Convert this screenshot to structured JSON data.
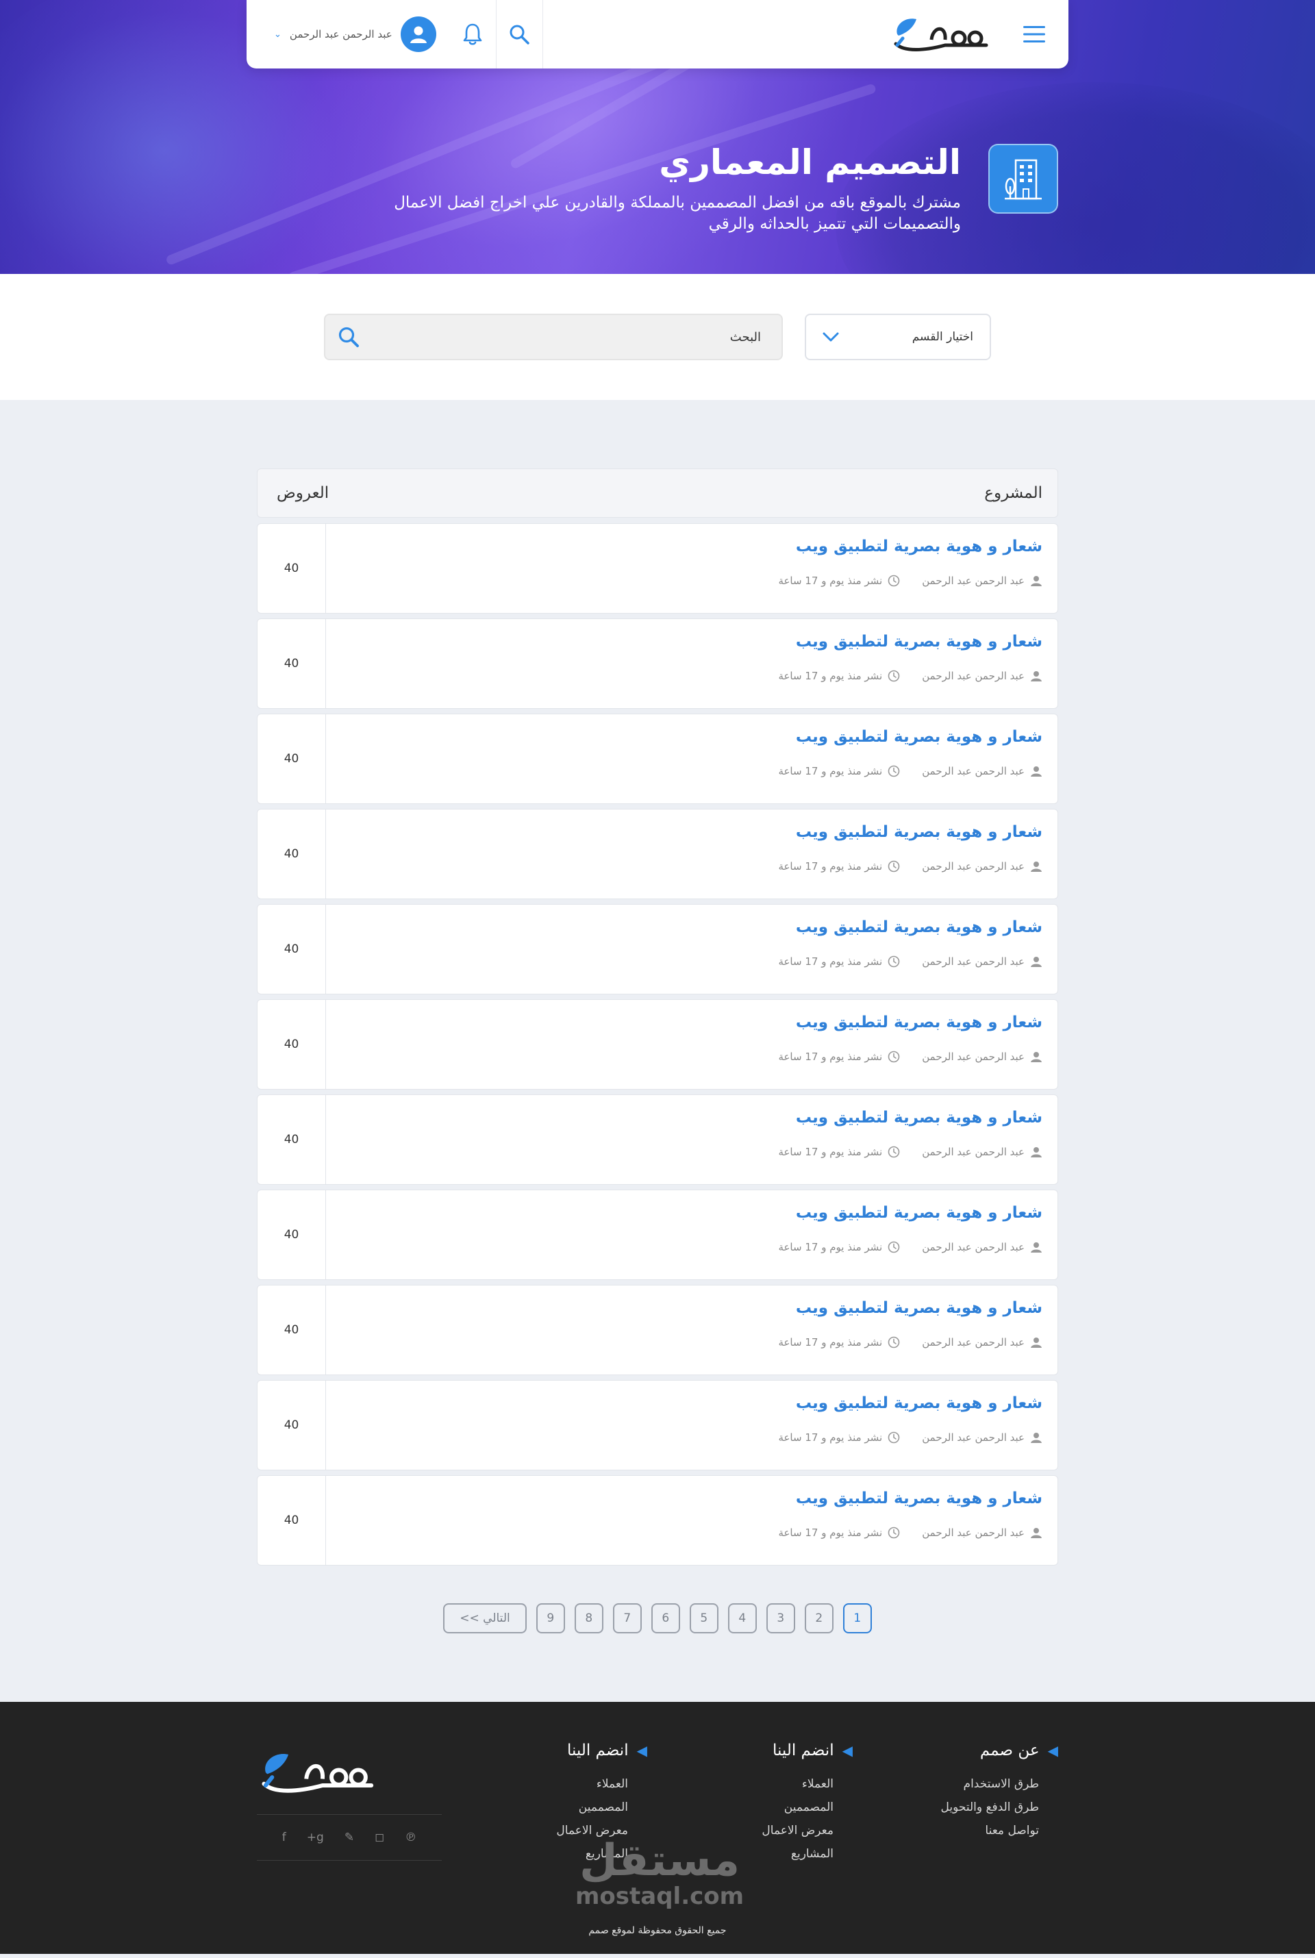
{
  "brand": {
    "name": "صمم"
  },
  "nav": {
    "user_name": "عبد الرحمن عبد الرحمن",
    "icons": [
      "menu-icon",
      "search-icon",
      "bell-icon",
      "user-icon",
      "chevron-down-icon"
    ]
  },
  "hero": {
    "title": "التصميم المعماري",
    "description": "مشترك بالموقع باقه من افضل المصممين بالمملكة والقادرين علي اخراج افضل الاعمال والتصميمات التي تتميز بالحداثه والرقي",
    "icon": "building-icon"
  },
  "filters": {
    "select_label": "اختيار القسم",
    "search_placeholder": "البحث"
  },
  "table": {
    "col_project": "المشروع",
    "col_offers": "العروض",
    "rows": [
      {
        "title": "شعار و هوية بصرية لتطبيق ويب",
        "author": "عبد الرحمن عبد الرحمن",
        "posted": "نشر منذ يوم و 17 ساعة",
        "offers": "40"
      },
      {
        "title": "شعار و هوية بصرية لتطبيق ويب",
        "author": "عبد الرحمن عبد الرحمن",
        "posted": "نشر منذ يوم و 17 ساعة",
        "offers": "40"
      },
      {
        "title": "شعار و هوية بصرية لتطبيق ويب",
        "author": "عبد الرحمن عبد الرحمن",
        "posted": "نشر منذ يوم و 17 ساعة",
        "offers": "40"
      },
      {
        "title": "شعار و هوية بصرية لتطبيق ويب",
        "author": "عبد الرحمن عبد الرحمن",
        "posted": "نشر منذ يوم و 17 ساعة",
        "offers": "40"
      },
      {
        "title": "شعار و هوية بصرية لتطبيق ويب",
        "author": "عبد الرحمن عبد الرحمن",
        "posted": "نشر منذ يوم و 17 ساعة",
        "offers": "40"
      },
      {
        "title": "شعار و هوية بصرية لتطبيق ويب",
        "author": "عبد الرحمن عبد الرحمن",
        "posted": "نشر منذ يوم و 17 ساعة",
        "offers": "40"
      },
      {
        "title": "شعار و هوية بصرية لتطبيق ويب",
        "author": "عبد الرحمن عبد الرحمن",
        "posted": "نشر منذ يوم و 17 ساعة",
        "offers": "40"
      },
      {
        "title": "شعار و هوية بصرية لتطبيق ويب",
        "author": "عبد الرحمن عبد الرحمن",
        "posted": "نشر منذ يوم و 17 ساعة",
        "offers": "40"
      },
      {
        "title": "شعار و هوية بصرية لتطبيق ويب",
        "author": "عبد الرحمن عبد الرحمن",
        "posted": "نشر منذ يوم و 17 ساعة",
        "offers": "40"
      },
      {
        "title": "شعار و هوية بصرية لتطبيق ويب",
        "author": "عبد الرحمن عبد الرحمن",
        "posted": "نشر منذ يوم و 17 ساعة",
        "offers": "40"
      },
      {
        "title": "شعار و هوية بصرية لتطبيق ويب",
        "author": "عبد الرحمن عبد الرحمن",
        "posted": "نشر منذ يوم و 17 ساعة",
        "offers": "40"
      }
    ]
  },
  "pagination": {
    "pages": [
      "1",
      "2",
      "3",
      "4",
      "5",
      "6",
      "7",
      "8",
      "9"
    ],
    "active": "1",
    "next_label": "التالي >>"
  },
  "footer": {
    "col1": {
      "title": "عن صمم",
      "links": [
        "طرق الاستخدام",
        "طرق الدفع والتحويل",
        "تواصل معنا"
      ]
    },
    "col2": {
      "title": "انضم الينا",
      "links": [
        "العملاء",
        "المصممين",
        "معرض الاعمال",
        "المشاريع"
      ]
    },
    "col3": {
      "title": "انضم الينا",
      "links": [
        "العملاء",
        "المصممين",
        "معرض الاعمال",
        "المشاريع"
      ]
    },
    "social": [
      "pinterest-icon",
      "instagram-icon",
      "twitter-icon",
      "google-plus-icon",
      "facebook-icon"
    ],
    "watermark_ar": "مستقل",
    "watermark_en": "mostaql.com",
    "copyright": "جميع الحقوق محفوظة لموقع صمم"
  },
  "colors": {
    "accent": "#2f8be6",
    "link": "#2f80d8",
    "footer_bg": "#232323",
    "page_bg": "#eceff4"
  }
}
